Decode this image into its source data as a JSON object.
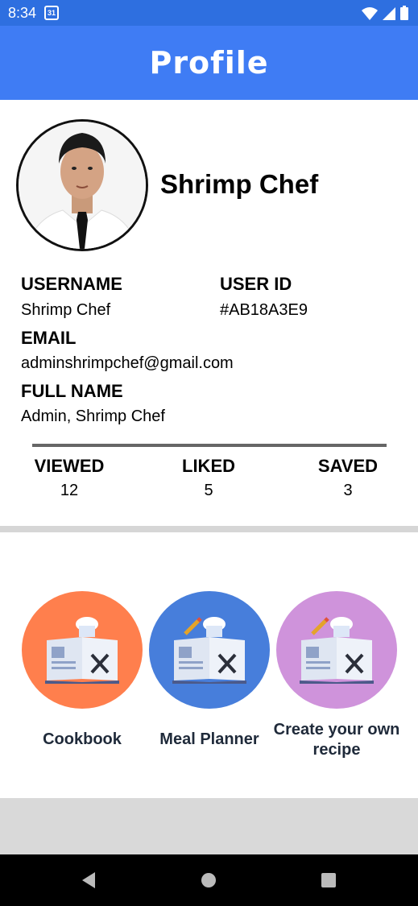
{
  "status_bar": {
    "time": "8:34",
    "calendar_day": "31"
  },
  "header": {
    "title": "Profile"
  },
  "profile": {
    "display_name": "Shrimp Chef"
  },
  "fields": {
    "username_label": "USERNAME",
    "username_value": "Shrimp Chef",
    "user_id_label": "USER ID",
    "user_id_value": "#AB18A3E9",
    "email_label": "EMAIL",
    "email_value": "adminshrimpchef@gmail.com",
    "full_name_label": "FULL NAME",
    "full_name_value": "Admin, Shrimp Chef"
  },
  "stats": [
    {
      "label": "VIEWED",
      "value": "12"
    },
    {
      "label": "LIKED",
      "value": "5"
    },
    {
      "label": "SAVED",
      "value": "3"
    }
  ],
  "actions": [
    {
      "label": "Cookbook",
      "color": "#ff7f4d"
    },
    {
      "label": "Meal Planner",
      "color": "#477edb"
    },
    {
      "label": "Create your own recipe",
      "color": "#cf93db"
    }
  ],
  "icons": {
    "avatar": "profile-photo",
    "action": "recipe-book-chef-hat-icon"
  },
  "colors": {
    "status_bar": "#2e6fe0",
    "header": "#3f7cf4"
  }
}
